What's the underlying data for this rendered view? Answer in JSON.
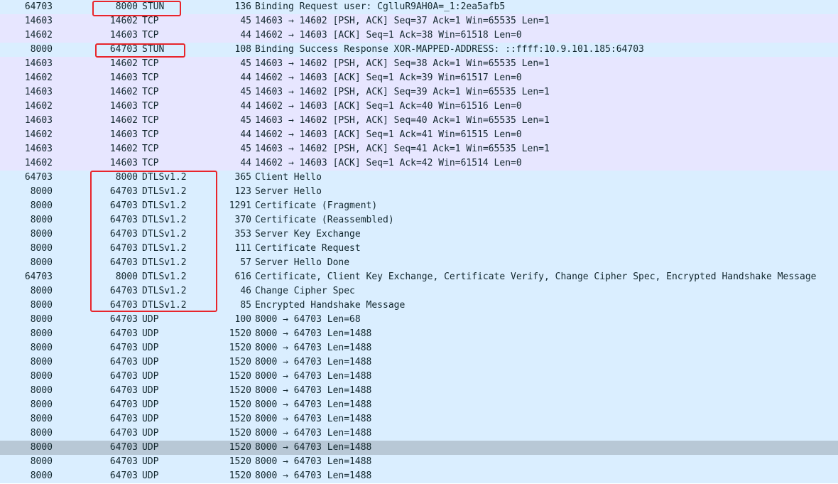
{
  "packets": [
    {
      "src": "64703",
      "dst": "8000",
      "proto": "STUN",
      "len": "136",
      "info": "Binding Request user: CglluR9AH0A=_1:2ea5afb5",
      "kind": "stun"
    },
    {
      "src": "14603",
      "dst": "14602",
      "proto": "TCP",
      "len": "45",
      "info": "14603 → 14602 [PSH, ACK] Seq=37 Ack=1 Win=65535 Len=1",
      "kind": "tcp"
    },
    {
      "src": "14602",
      "dst": "14603",
      "proto": "TCP",
      "len": "44",
      "info": "14602 → 14603 [ACK] Seq=1 Ack=38 Win=61518 Len=0",
      "kind": "tcp"
    },
    {
      "src": "8000",
      "dst": "64703",
      "proto": "STUN",
      "len": "108",
      "info": "Binding Success Response XOR-MAPPED-ADDRESS: ::ffff:10.9.101.185:64703",
      "kind": "stun"
    },
    {
      "src": "14603",
      "dst": "14602",
      "proto": "TCP",
      "len": "45",
      "info": "14603 → 14602 [PSH, ACK] Seq=38 Ack=1 Win=65535 Len=1",
      "kind": "tcp"
    },
    {
      "src": "14602",
      "dst": "14603",
      "proto": "TCP",
      "len": "44",
      "info": "14602 → 14603 [ACK] Seq=1 Ack=39 Win=61517 Len=0",
      "kind": "tcp"
    },
    {
      "src": "14603",
      "dst": "14602",
      "proto": "TCP",
      "len": "45",
      "info": "14603 → 14602 [PSH, ACK] Seq=39 Ack=1 Win=65535 Len=1",
      "kind": "tcp"
    },
    {
      "src": "14602",
      "dst": "14603",
      "proto": "TCP",
      "len": "44",
      "info": "14602 → 14603 [ACK] Seq=1 Ack=40 Win=61516 Len=0",
      "kind": "tcp"
    },
    {
      "src": "14603",
      "dst": "14602",
      "proto": "TCP",
      "len": "45",
      "info": "14603 → 14602 [PSH, ACK] Seq=40 Ack=1 Win=65535 Len=1",
      "kind": "tcp"
    },
    {
      "src": "14602",
      "dst": "14603",
      "proto": "TCP",
      "len": "44",
      "info": "14602 → 14603 [ACK] Seq=1 Ack=41 Win=61515 Len=0",
      "kind": "tcp"
    },
    {
      "src": "14603",
      "dst": "14602",
      "proto": "TCP",
      "len": "45",
      "info": "14603 → 14602 [PSH, ACK] Seq=41 Ack=1 Win=65535 Len=1",
      "kind": "tcp"
    },
    {
      "src": "14602",
      "dst": "14603",
      "proto": "TCP",
      "len": "44",
      "info": "14602 → 14603 [ACK] Seq=1 Ack=42 Win=61514 Len=0",
      "kind": "tcp"
    },
    {
      "src": "64703",
      "dst": "8000",
      "proto": "DTLSv1.2",
      "len": "365",
      "info": "Client Hello",
      "kind": "dtls"
    },
    {
      "src": "8000",
      "dst": "64703",
      "proto": "DTLSv1.2",
      "len": "123",
      "info": "Server Hello",
      "kind": "dtls"
    },
    {
      "src": "8000",
      "dst": "64703",
      "proto": "DTLSv1.2",
      "len": "1291",
      "info": "Certificate (Fragment)",
      "kind": "dtls"
    },
    {
      "src": "8000",
      "dst": "64703",
      "proto": "DTLSv1.2",
      "len": "370",
      "info": "Certificate (Reassembled)",
      "kind": "dtls"
    },
    {
      "src": "8000",
      "dst": "64703",
      "proto": "DTLSv1.2",
      "len": "353",
      "info": "Server Key Exchange",
      "kind": "dtls"
    },
    {
      "src": "8000",
      "dst": "64703",
      "proto": "DTLSv1.2",
      "len": "111",
      "info": "Certificate Request",
      "kind": "dtls"
    },
    {
      "src": "8000",
      "dst": "64703",
      "proto": "DTLSv1.2",
      "len": "57",
      "info": "Server Hello Done",
      "kind": "dtls"
    },
    {
      "src": "64703",
      "dst": "8000",
      "proto": "DTLSv1.2",
      "len": "616",
      "info": "Certificate, Client Key Exchange, Certificate Verify, Change Cipher Spec, Encrypted Handshake Message",
      "kind": "dtls"
    },
    {
      "src": "8000",
      "dst": "64703",
      "proto": "DTLSv1.2",
      "len": "46",
      "info": "Change Cipher Spec",
      "kind": "dtls"
    },
    {
      "src": "8000",
      "dst": "64703",
      "proto": "DTLSv1.2",
      "len": "85",
      "info": "Encrypted Handshake Message",
      "kind": "dtls"
    },
    {
      "src": "8000",
      "dst": "64703",
      "proto": "UDP",
      "len": "100",
      "info": "8000 → 64703 Len=68",
      "kind": "udp"
    },
    {
      "src": "8000",
      "dst": "64703",
      "proto": "UDP",
      "len": "1520",
      "info": "8000 → 64703 Len=1488",
      "kind": "udp"
    },
    {
      "src": "8000",
      "dst": "64703",
      "proto": "UDP",
      "len": "1520",
      "info": "8000 → 64703 Len=1488",
      "kind": "udp"
    },
    {
      "src": "8000",
      "dst": "64703",
      "proto": "UDP",
      "len": "1520",
      "info": "8000 → 64703 Len=1488",
      "kind": "udp"
    },
    {
      "src": "8000",
      "dst": "64703",
      "proto": "UDP",
      "len": "1520",
      "info": "8000 → 64703 Len=1488",
      "kind": "udp"
    },
    {
      "src": "8000",
      "dst": "64703",
      "proto": "UDP",
      "len": "1520",
      "info": "8000 → 64703 Len=1488",
      "kind": "udp"
    },
    {
      "src": "8000",
      "dst": "64703",
      "proto": "UDP",
      "len": "1520",
      "info": "8000 → 64703 Len=1488",
      "kind": "udp"
    },
    {
      "src": "8000",
      "dst": "64703",
      "proto": "UDP",
      "len": "1520",
      "info": "8000 → 64703 Len=1488",
      "kind": "udp"
    },
    {
      "src": "8000",
      "dst": "64703",
      "proto": "UDP",
      "len": "1520",
      "info": "8000 → 64703 Len=1488",
      "kind": "udp"
    },
    {
      "src": "8000",
      "dst": "64703",
      "proto": "UDP",
      "len": "1520",
      "info": "8000 → 64703 Len=1488",
      "kind": "udp",
      "selected": true
    },
    {
      "src": "8000",
      "dst": "64703",
      "proto": "UDP",
      "len": "1520",
      "info": "8000 → 64703 Len=1488",
      "kind": "udp"
    },
    {
      "src": "8000",
      "dst": "64703",
      "proto": "UDP",
      "len": "1520",
      "info": "8000 → 64703 Len=1488",
      "kind": "udp"
    }
  ],
  "colors": {
    "udp_row": "#daeeff",
    "tcp_row": "#e7e6ff",
    "selected_row": "#b8c8d6",
    "annotation": "#e8252b"
  }
}
